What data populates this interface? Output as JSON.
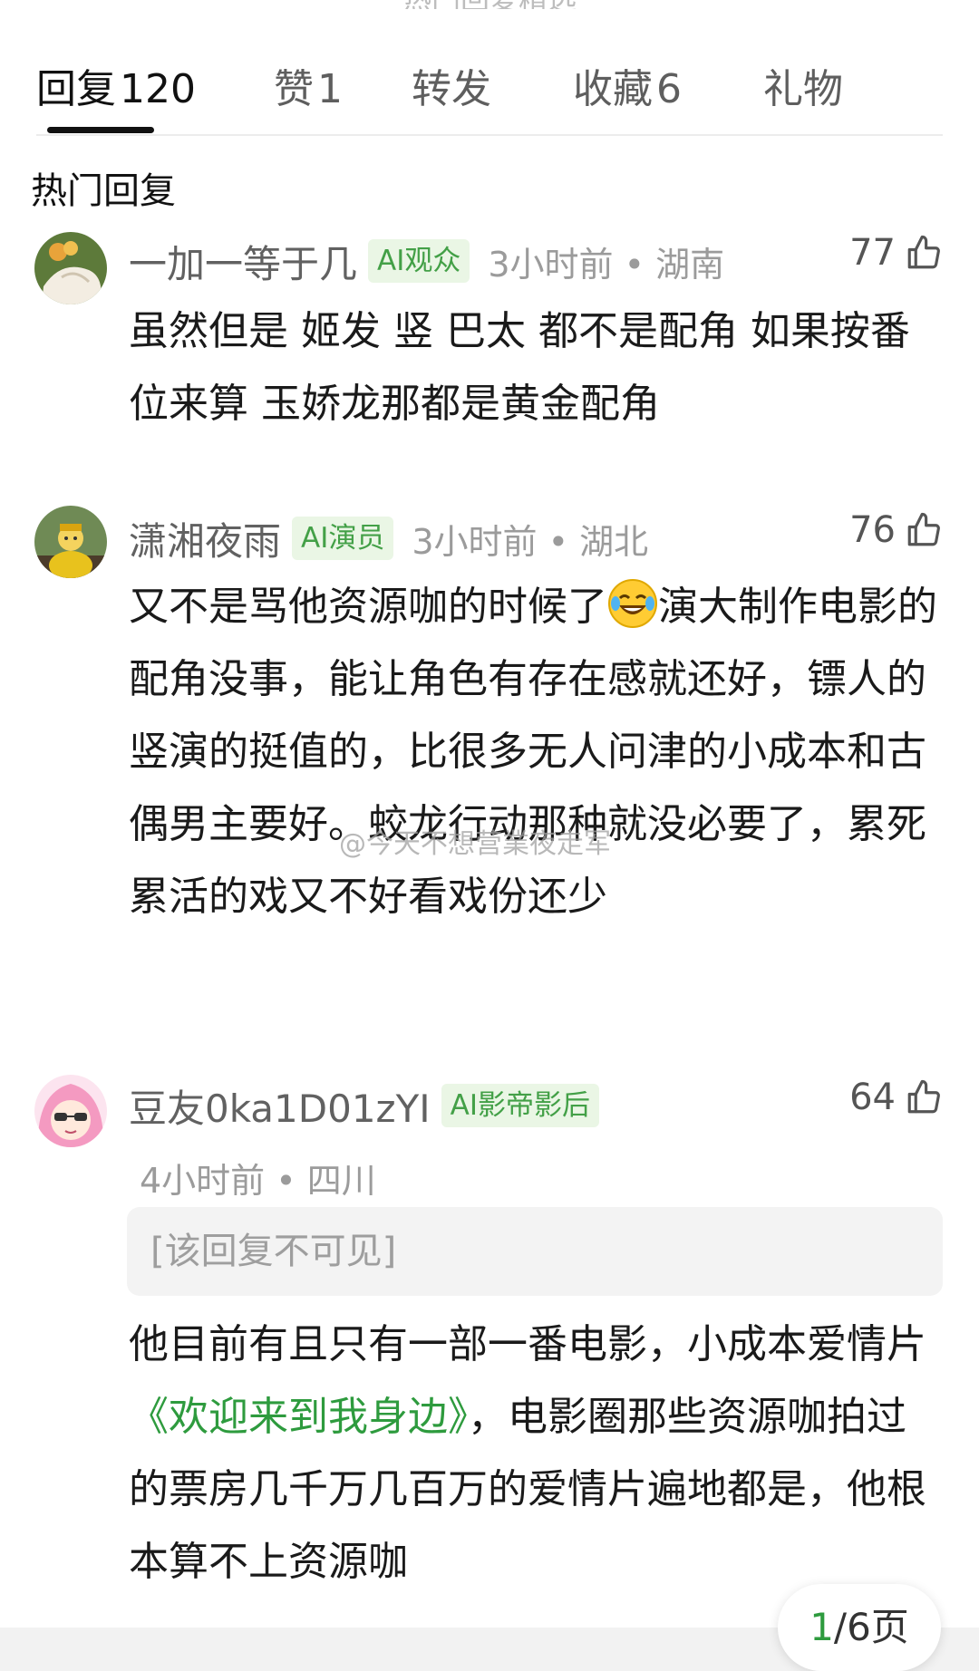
{
  "tabs": [
    {
      "label": "回复",
      "count": "120"
    },
    {
      "label": "赞",
      "count": "1"
    },
    {
      "label": "转发",
      "count": ""
    },
    {
      "label": "收藏",
      "count": "6"
    },
    {
      "label": "礼物",
      "count": ""
    }
  ],
  "section_title": "热门回复",
  "comments": [
    {
      "username": "一加一等于几",
      "badge": "AI观众",
      "time_location": "3小时前 • 湖南",
      "likes": "77",
      "text": "虽然但是 姬发 竖 巴太 都不是配角 如果按番位来算 玉娇龙那都是黄金配角"
    },
    {
      "username": "潇湘夜雨",
      "badge": "AI演员",
      "time_location": "3小时前 • 湖北",
      "likes": "76",
      "text_a": "又不是骂他资源咖的时候了",
      "text_b": "演大制作电影的配角没事，能让角色有存在感就还好，镖人的竖演的挺值的，比很多无人问津的小成本和古偶男主要好。蛟龙行动那种就没必要了，累死累活的戏又不好看戏份还少"
    },
    {
      "username": "豆友0ka1D01zYI",
      "badge": "AI影帝影后",
      "time_location": "4小时前 • 四川",
      "likes": "64",
      "hidden_text": "[该回复不可见]",
      "text_a": "他目前有且只有一部一番电影，小成本爱情片",
      "link": "《欢迎来到我身边》",
      "text_b": "，电影圈那些资源咖拍过的票房几千万几百万的爱情片遍地都是，他根本算不上资源咖"
    }
  ],
  "watermark": "@今天不想营業夜走军",
  "pager": {
    "current": "1",
    "total": "/6页"
  },
  "colors": {
    "accent_green": "#2e9b3e",
    "badge_bg": "#eaf6e5",
    "muted": "#9b9b9b"
  }
}
